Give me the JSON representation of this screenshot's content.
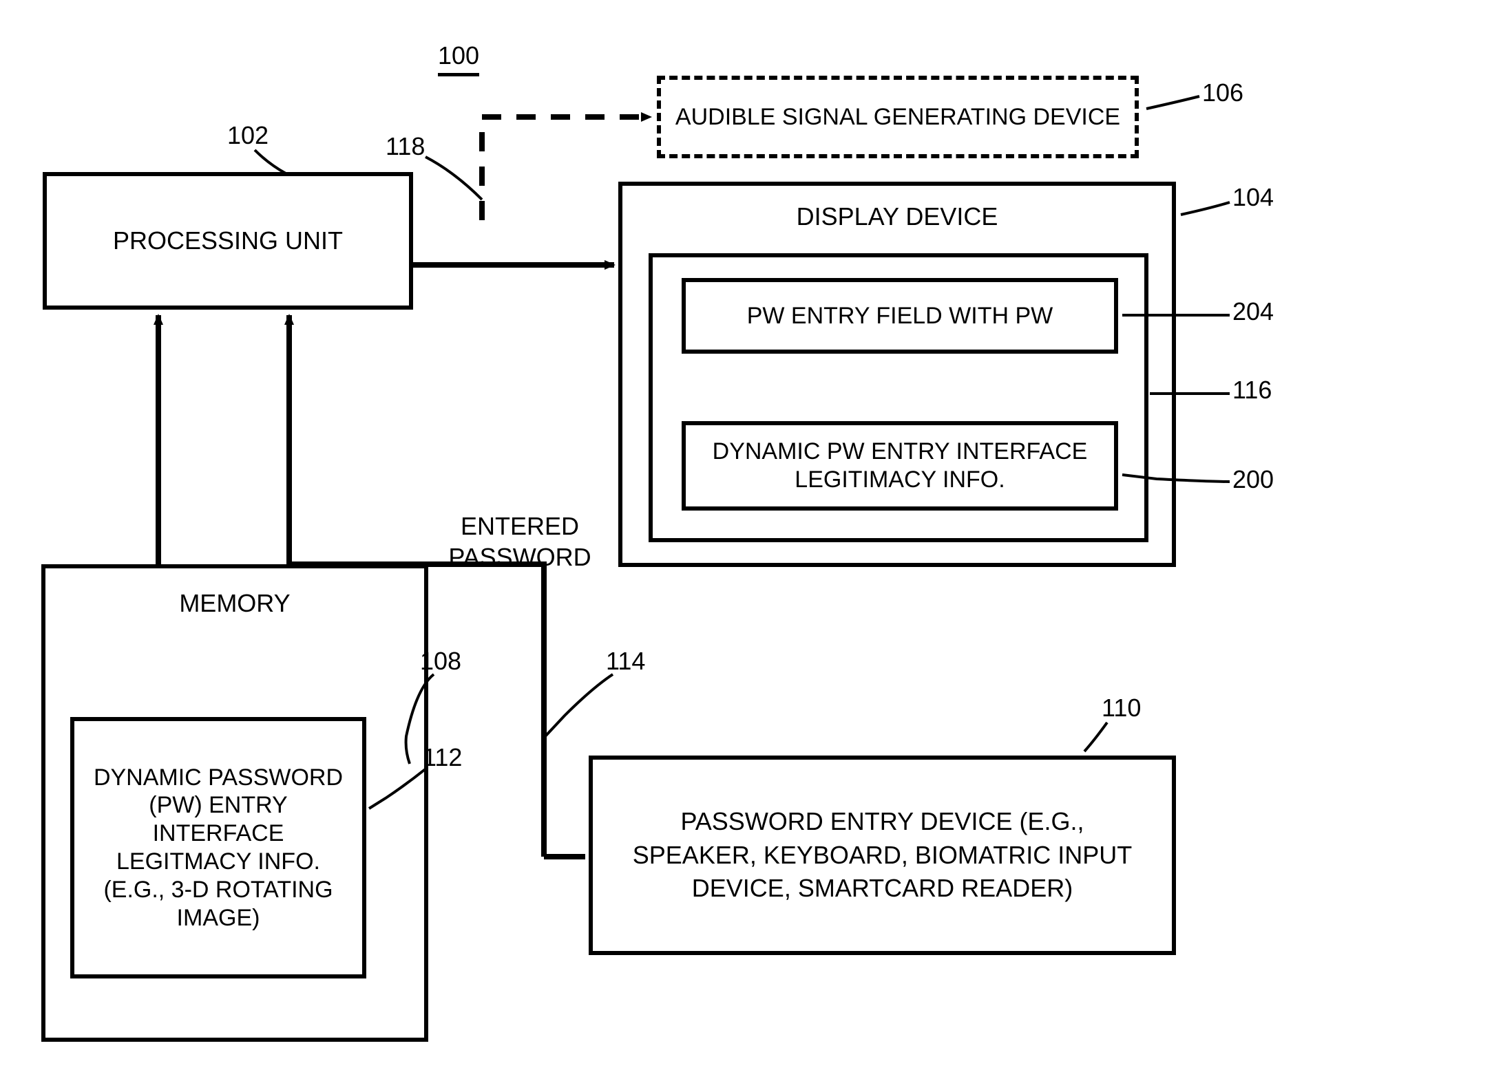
{
  "ref": {
    "num100": "100",
    "num102": "102",
    "num104": "104",
    "num106": "106",
    "num108": "108",
    "num110": "110",
    "num112": "112",
    "num114": "114",
    "num116": "116",
    "num118": "118",
    "num200": "200",
    "num204": "204"
  },
  "blocks": {
    "processing": "PROCESSING UNIT",
    "memory": "MEMORY",
    "memory_inner": "DYNAMIC PASSWORD (PW) ENTRY INTERFACE LEGITMACY INFO. (E.G., 3-D ROTATING IMAGE)",
    "entered_password": "ENTERED PASSWORD",
    "audible": "AUDIBLE SIGNAL GENERATING DEVICE",
    "display": "DISPLAY DEVICE",
    "pw_field": "PW ENTRY FIELD WITH PW",
    "pw_legitimacy": "DYNAMIC PW ENTRY INTERFACE LEGITIMACY INFO.",
    "password_entry_device": "PASSWORD ENTRY DEVICE (E.G., SPEAKER, KEYBOARD, BIOMATRIC INPUT DEVICE, SMARTCARD READER)"
  }
}
